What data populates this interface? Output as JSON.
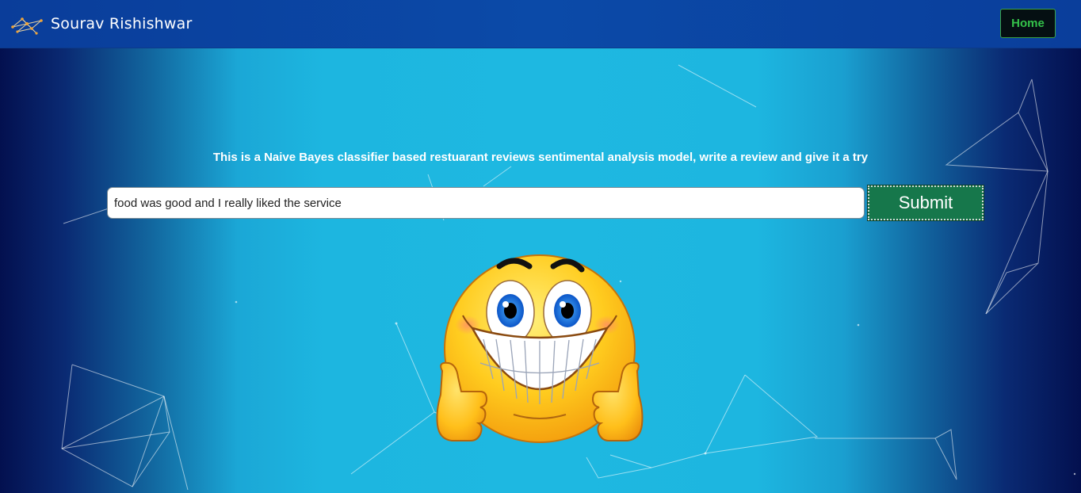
{
  "navbar": {
    "brand_name": "Sourav Rishishwar",
    "home_label": "Home",
    "home_color": "#34c24a"
  },
  "main": {
    "intro_text": "This is a Naive Bayes classifier based restuarant reviews sentimental analysis model, write a review and give it a try",
    "review_input_value": "food was good and I really liked the service",
    "submit_label": "Submit",
    "result_icon": "happy-thumbs-up-emoji-icon"
  },
  "colors": {
    "navbar": "#0b4aa8",
    "background_center": "#1eb8e1",
    "background_edge": "#03104f",
    "submit": "#16774b"
  }
}
